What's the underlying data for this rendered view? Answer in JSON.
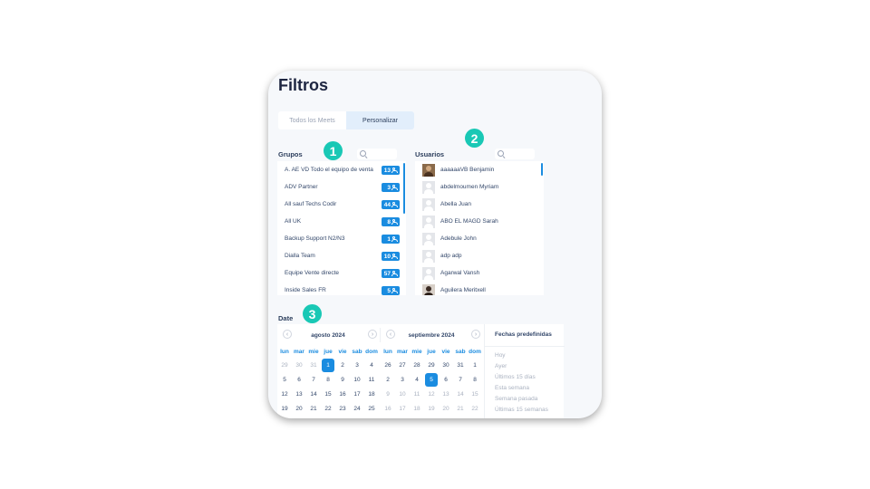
{
  "title": "Filtros",
  "tabs": [
    {
      "label": "Todos los Meets"
    },
    {
      "label": "Personalizar"
    }
  ],
  "steps": [
    "1",
    "2",
    "3"
  ],
  "grupos": {
    "label": "Grupos",
    "items": [
      {
        "name": "A. AE VD Todo el equipo de venta",
        "count": "13"
      },
      {
        "name": "ADV Partner",
        "count": "3"
      },
      {
        "name": "All sauf Techs Codir",
        "count": "44"
      },
      {
        "name": "All UK",
        "count": "8"
      },
      {
        "name": "Backup Support N2/N3",
        "count": "1"
      },
      {
        "name": "Dialla Team",
        "count": "10"
      },
      {
        "name": "Equipe Vente directe",
        "count": "57"
      },
      {
        "name": "Inside Sales FR",
        "count": "5"
      }
    ]
  },
  "usuarios": {
    "label": "Usuarios",
    "items": [
      {
        "name": "aaaaaaVB Benjamin",
        "avatar": "photo"
      },
      {
        "name": "abdelmoumen Myriam",
        "avatar": "default"
      },
      {
        "name": "Abella Juan",
        "avatar": "default"
      },
      {
        "name": "ABO EL MAGD Sarah",
        "avatar": "default"
      },
      {
        "name": "Adebule John",
        "avatar": "default"
      },
      {
        "name": "adp adp",
        "avatar": "default"
      },
      {
        "name": "Agarwal Vansh",
        "avatar": "default"
      },
      {
        "name": "Aguilera Meritxell",
        "avatar": "photo2"
      }
    ]
  },
  "date": {
    "label": "Date",
    "weekdays": [
      "lun",
      "mar",
      "mie",
      "jue",
      "vie",
      "sab",
      "dom"
    ],
    "months": [
      {
        "title": "agosto 2024",
        "days": [
          {
            "d": "29",
            "m": true
          },
          {
            "d": "30",
            "m": true
          },
          {
            "d": "31",
            "m": true
          },
          {
            "d": "1",
            "sel": true
          },
          {
            "d": "2"
          },
          {
            "d": "3"
          },
          {
            "d": "4"
          },
          {
            "d": "5"
          },
          {
            "d": "6"
          },
          {
            "d": "7"
          },
          {
            "d": "8"
          },
          {
            "d": "9"
          },
          {
            "d": "10"
          },
          {
            "d": "11"
          },
          {
            "d": "12"
          },
          {
            "d": "13"
          },
          {
            "d": "14"
          },
          {
            "d": "15"
          },
          {
            "d": "16"
          },
          {
            "d": "17"
          },
          {
            "d": "18"
          },
          {
            "d": "19"
          },
          {
            "d": "20"
          },
          {
            "d": "21"
          },
          {
            "d": "22"
          },
          {
            "d": "23"
          },
          {
            "d": "24"
          },
          {
            "d": "25"
          }
        ]
      },
      {
        "title": "septiembre 2024",
        "days": [
          {
            "d": "26"
          },
          {
            "d": "27"
          },
          {
            "d": "28"
          },
          {
            "d": "29"
          },
          {
            "d": "30"
          },
          {
            "d": "31"
          },
          {
            "d": "1"
          },
          {
            "d": "2"
          },
          {
            "d": "3"
          },
          {
            "d": "4"
          },
          {
            "d": "5",
            "sel": true
          },
          {
            "d": "6"
          },
          {
            "d": "7"
          },
          {
            "d": "8"
          },
          {
            "d": "9",
            "m": true
          },
          {
            "d": "10",
            "m": true
          },
          {
            "d": "11",
            "m": true
          },
          {
            "d": "12",
            "m": true
          },
          {
            "d": "13",
            "m": true
          },
          {
            "d": "14",
            "m": true
          },
          {
            "d": "15",
            "m": true
          },
          {
            "d": "16",
            "m": true
          },
          {
            "d": "17",
            "m": true
          },
          {
            "d": "18",
            "m": true
          },
          {
            "d": "19",
            "m": true
          },
          {
            "d": "20",
            "m": true
          },
          {
            "d": "21",
            "m": true
          },
          {
            "d": "22",
            "m": true
          }
        ]
      }
    ],
    "presets_title": "Fechas predefinidas",
    "presets": [
      "Hoy",
      "Ayer",
      "Últimos 15 días",
      "Esta semana",
      "Semana pasada",
      "Últimas 15 semanas"
    ]
  },
  "colors": {
    "accent": "#1a8ce0",
    "step": "#19c8b5",
    "title": "#1d2540"
  }
}
